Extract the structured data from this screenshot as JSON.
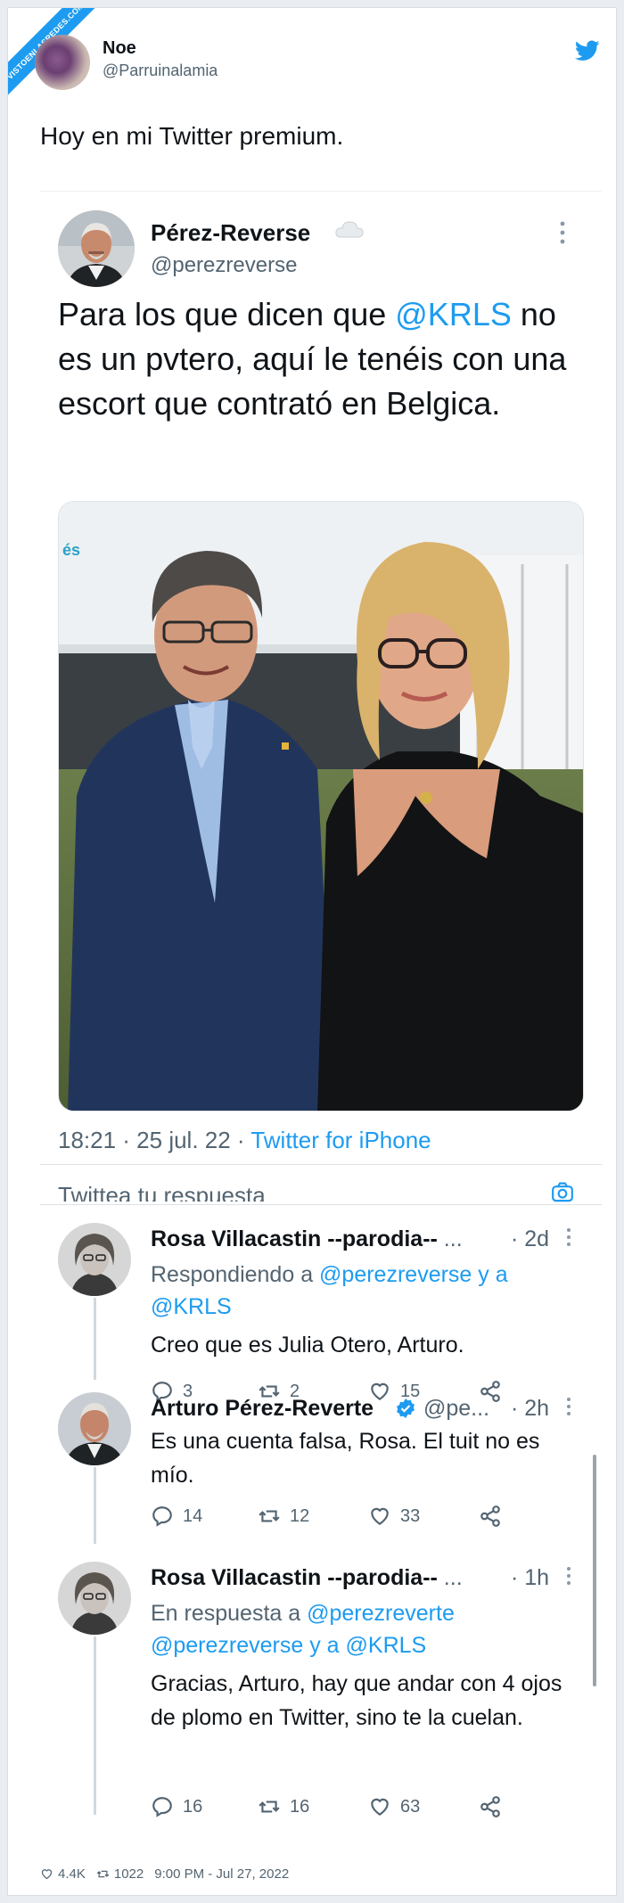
{
  "watermark": "VISTOENLASREDES.COM",
  "author": {
    "name": "Noe",
    "handle": "@Parruinalamia"
  },
  "tweet_text": "Hoy en mi Twitter premium.",
  "quoted": {
    "name": "Pérez-Reverse",
    "handle": "@perezreverse",
    "text_before": "Para los que dicen que ",
    "mention": "@KRLS",
    "text_after": " no es un pvtero, aquí le tenéis con una escort que contrató en Belgica.",
    "time": "18:21 · 25 jul. 22 · ",
    "source": "Twitter for iPhone",
    "reply_placeholder": "Twittea tu respuesta"
  },
  "replies": [
    {
      "name": "Rosa Villacastin --parodia--",
      "ellipsis": "...",
      "time": "· 2d",
      "context_prefix": "Respondiendo a ",
      "context_link1": "@perezreverse",
      "context_mid": " y a",
      "context_link2": "@KRLS",
      "body": "Creo que es Julia Otero, Arturo.",
      "replies": "3",
      "retweets": "2",
      "likes": "15"
    },
    {
      "name": "Arturo Pérez-Reverte",
      "handle": "@pe...",
      "time": "· 2h",
      "body": "Es una cuenta falsa, Rosa. El tuit no es mío.",
      "replies": "14",
      "retweets": "12",
      "likes": "33"
    },
    {
      "name": "Rosa Villacastin --parodia--",
      "ellipsis": "...",
      "time": "· 1h",
      "context_prefix": "En respuesta a ",
      "context_link1": "@perezreverte",
      "context_line2_link1": "@perezreverse",
      "context_line2_mid": " y a ",
      "context_line2_link2": "@KRLS",
      "body": "Gracias, Arturo, hay que andar con 4 ojos de plomo en Twitter, sino te la cuelan.",
      "replies": "16",
      "retweets": "16",
      "likes": "63"
    }
  ],
  "footer": {
    "likes": "4.4K",
    "retweets": "1022",
    "timestamp": "9:00 PM - Jul 27, 2022"
  },
  "colors": {
    "accent": "#1d9bf0",
    "muted": "#536471",
    "text": "#0f1419",
    "verified": "#1d9bf0"
  }
}
